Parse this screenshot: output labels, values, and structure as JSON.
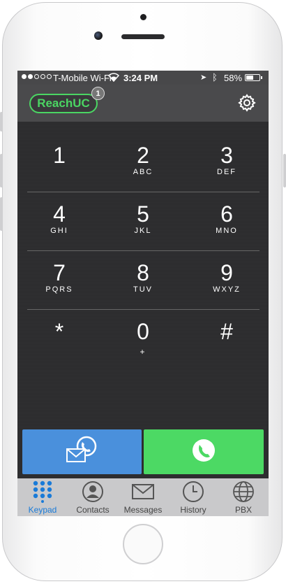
{
  "status_bar": {
    "carrier": "T-Mobile Wi-Fi",
    "time": "3:24 PM",
    "battery": "58%",
    "battery_level": 0.58
  },
  "header": {
    "logo": "ReachUC",
    "badge_count": "1"
  },
  "keypad": {
    "keys": [
      {
        "digit": "1",
        "letters": ""
      },
      {
        "digit": "2",
        "letters": "ABC"
      },
      {
        "digit": "3",
        "letters": "DEF"
      },
      {
        "digit": "4",
        "letters": "GHI"
      },
      {
        "digit": "5",
        "letters": "JKL"
      },
      {
        "digit": "6",
        "letters": "MNO"
      },
      {
        "digit": "7",
        "letters": "PQRS"
      },
      {
        "digit": "8",
        "letters": "TUV"
      },
      {
        "digit": "9",
        "letters": "WXYZ"
      },
      {
        "digit": "*",
        "letters": ""
      },
      {
        "digit": "0",
        "letters": "+"
      },
      {
        "digit": "#",
        "letters": ""
      }
    ]
  },
  "tabs": [
    {
      "label": "Keypad",
      "icon": "keypad-icon",
      "active": true
    },
    {
      "label": "Contacts",
      "icon": "contacts-icon",
      "active": false
    },
    {
      "label": "Messages",
      "icon": "messages-icon",
      "active": false
    },
    {
      "label": "History",
      "icon": "history-icon",
      "active": false
    },
    {
      "label": "PBX",
      "icon": "pbx-icon",
      "active": false
    }
  ],
  "colors": {
    "accent_green": "#4cd964",
    "accent_blue": "#4a90dc",
    "active_tab": "#1a7bd8"
  }
}
